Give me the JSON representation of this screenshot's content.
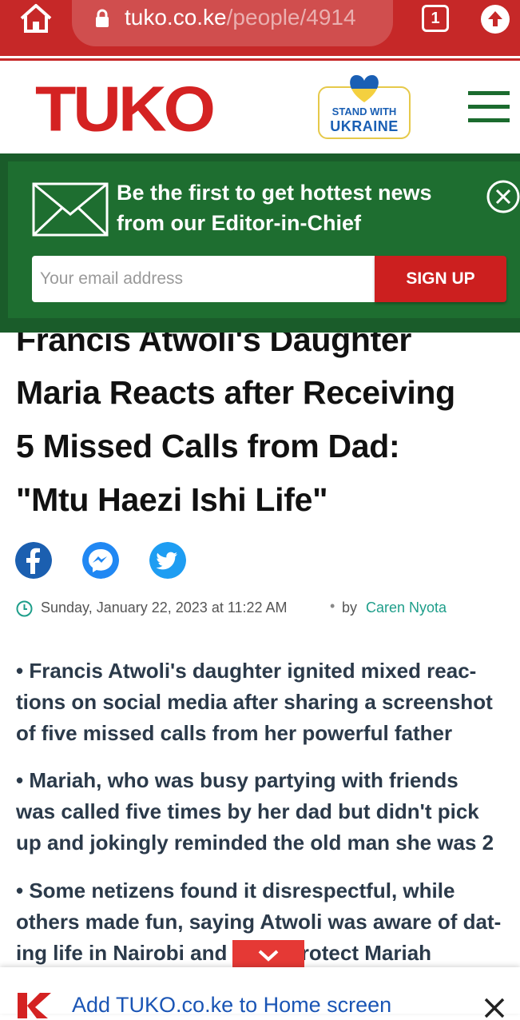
{
  "browser": {
    "url_host": "tuko.co.ke",
    "url_path": "/people/4914",
    "tab_count": "1"
  },
  "site": {
    "logo_text": "TUKO",
    "ukraine_badge": {
      "line1": "STAND WITH",
      "line2": "UKRAINE"
    }
  },
  "newsletter": {
    "headline_line1": "Be the first to get hottest news",
    "headline_line2": "from our Editor-in-Chief",
    "email_placeholder": "Your email address",
    "signup_label": "SIGN UP"
  },
  "article": {
    "title_lines": [
      "Francis Atwoli's Daughter",
      "Maria Reacts after Receiving",
      "5 Missed Calls from Dad:",
      "\"Mtu Haezi Ishi Life\""
    ],
    "date": "Sunday, January 22, 2023 at 11:22 AM",
    "separator": "•",
    "by": "by",
    "author": "Caren Nyota",
    "bullets": [
      [
        "•    Francis Atwoli's daughter ignited mixed reac-",
        "tions on social media after sharing a screenshot",
        "of five missed calls from her powerful father"
      ],
      [
        "•    Mariah, who was busy partying with friends",
        "was called five times by her dad but didn't pick",
        "up and jokingly reminded the old man she was 2"
      ],
      [
        "•    Some netizens found it disrespectful, while",
        "others made fun, saying Atwoli was aware of dat-",
        "ing life in Nairobi and                 ed to protect Mariah"
      ]
    ]
  },
  "add_to_home": {
    "label": "Add TUKO.co.ke to Home screen"
  },
  "colors": {
    "brand_red": "#d42222",
    "newsletter_green": "#1e6e30",
    "author_teal": "#1e9e8a",
    "facebook": "#1b5fb0",
    "messenger": "#2188f3",
    "twitter": "#1e9df2"
  },
  "icons": [
    "home-icon",
    "lock-icon",
    "tab-switcher-icon",
    "upload-icon",
    "hamburger-menu-icon",
    "mail-icon",
    "close-circle-icon",
    "facebook-icon",
    "messenger-icon",
    "twitter-icon",
    "clock-icon",
    "chevron-down-icon",
    "tuko-k-logo",
    "close-icon"
  ]
}
